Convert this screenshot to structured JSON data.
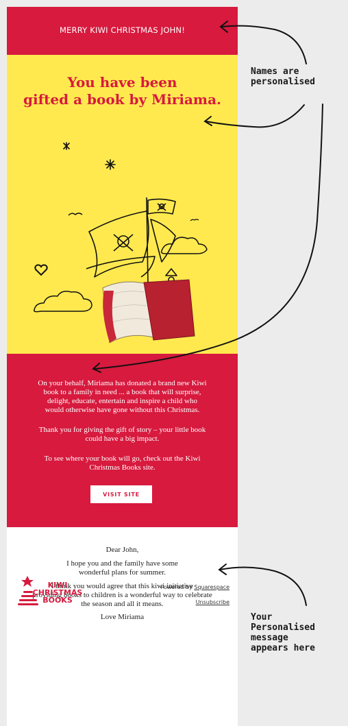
{
  "colors": {
    "brand_red": "#d71a3e",
    "hero_yellow": "#ffe94f",
    "background": "#ececec",
    "white": "#ffffff"
  },
  "email": {
    "greeting_banner": "MERRY KIWI CHRISTMAS JOHN!",
    "hero_title_line1": "You have been",
    "hero_title_line2": "gifted a book by Miriama.",
    "body": {
      "para1_line1": "On your behalf, Miriama has donated a brand new Kiwi",
      "para1_line2": "book to a family in need ... a book that will surprise,",
      "para1_line3": "delight, educate, entertain and inspire a child who",
      "para1_line4": "would otherwise have gone without this Christmas.",
      "para2_line1": "Thank you for giving the gift of story – your little book",
      "para2_line2": "could have a big impact.",
      "para3_line1": "To see where your book will go, check out the Kiwi",
      "para3_line2": "Christmas Books site.",
      "visit_button": "VISIT SITE"
    },
    "message": {
      "salutation": "Dear John,",
      "line1": "I hope you and the family have some",
      "line2": "wonderful plans for summer.",
      "line3": "I think you would agree that this kiwi initiative",
      "line4": "providing books to children is a wonderful way to celebrate",
      "line5": "the season and all it means.",
      "signoff": "Love Miriama"
    },
    "footer": {
      "logo_line1": "KIWI",
      "logo_line2": "CHRISTMAS",
      "logo_line3": "BOOKS",
      "powered_prefix": "Powered by ",
      "powered_link": "Squarespace",
      "unsubscribe": "Unsubscribe"
    },
    "icons": [
      "star-icon",
      "heart-icon",
      "bird-icon",
      "cloud-icon",
      "pirate-ship-icon",
      "open-book-icon",
      "christmas-tree-icon"
    ]
  },
  "annotations": {
    "note1_line1": "Names are",
    "note1_line2": "personalised",
    "note2_line1": "Your",
    "note2_line2": "Personalised",
    "note2_line3": "message",
    "note2_line4": "appears here"
  }
}
